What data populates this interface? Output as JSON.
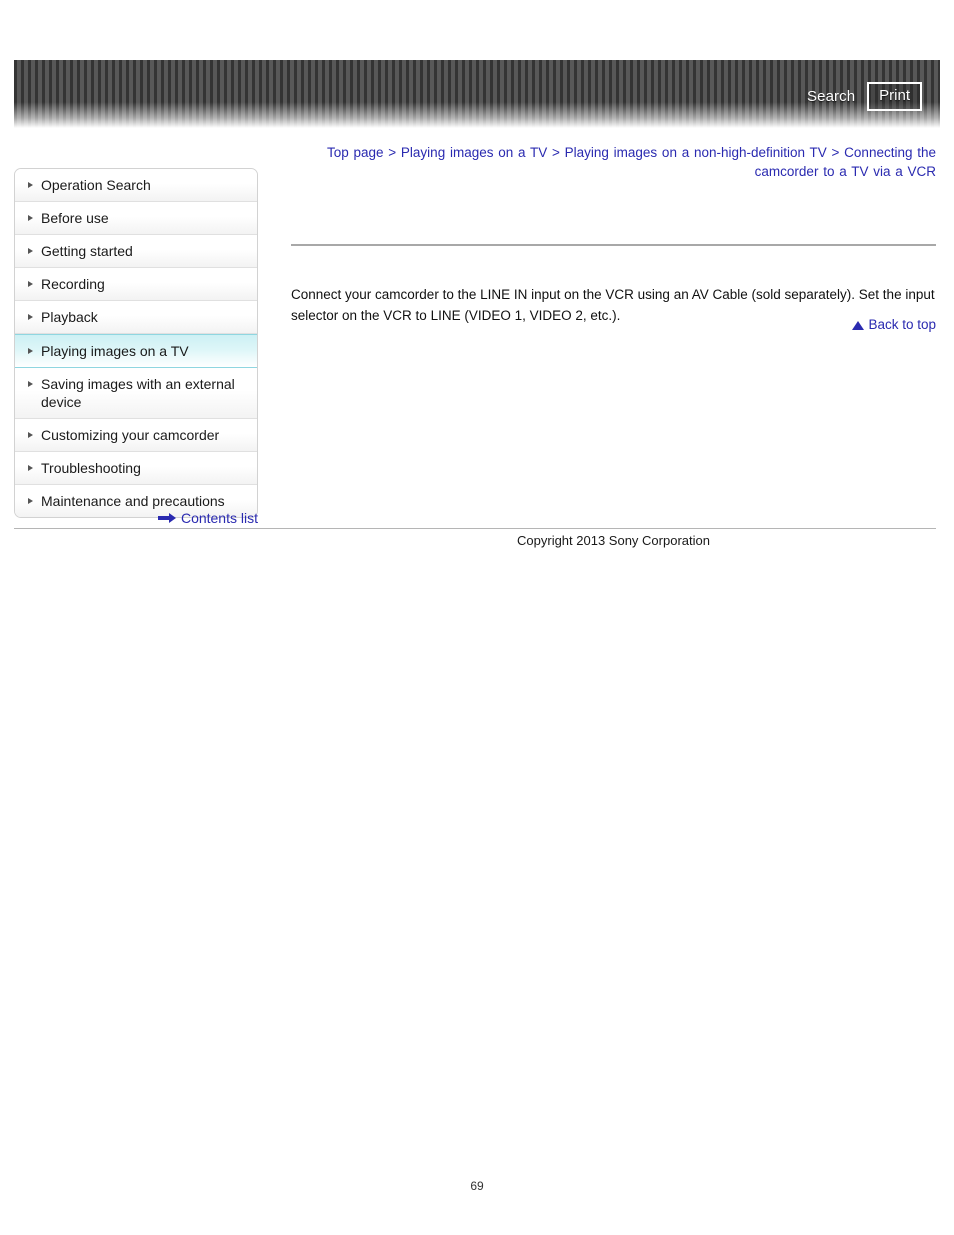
{
  "header": {
    "search_label": "Search",
    "print_label": "Print",
    "stripe_dark": "#343434",
    "stripe_light": "#585858"
  },
  "breadcrumb": {
    "text": "Top page > Playing images on a TV > Playing images on a non-high-definition TV > Connecting the camcorder to a TV via a VCR",
    "color": "#2a2ab0"
  },
  "sidebar": {
    "items": [
      {
        "label": "Operation Search",
        "active": false
      },
      {
        "label": "Before use",
        "active": false
      },
      {
        "label": "Getting started",
        "active": false
      },
      {
        "label": "Recording",
        "active": false
      },
      {
        "label": "Playback",
        "active": false
      },
      {
        "label": "Playing images on a TV",
        "active": true
      },
      {
        "label": "Saving images with an external device",
        "active": false
      },
      {
        "label": "Customizing your camcorder",
        "active": false
      },
      {
        "label": "Troubleshooting",
        "active": false
      },
      {
        "label": "Maintenance and precautions",
        "active": false
      }
    ],
    "contents_link": "Contents list",
    "active_highlight": "#cdf0f4"
  },
  "main": {
    "body_text": "Connect your camcorder to the LINE IN input on the VCR using an AV Cable (sold separately). Set the input selector on the VCR to LINE (VIDEO 1, VIDEO 2, etc.).",
    "back_to_top": "Back to top"
  },
  "footer": {
    "copyright": "Copyright 2013 Sony Corporation",
    "page_number": "69"
  }
}
